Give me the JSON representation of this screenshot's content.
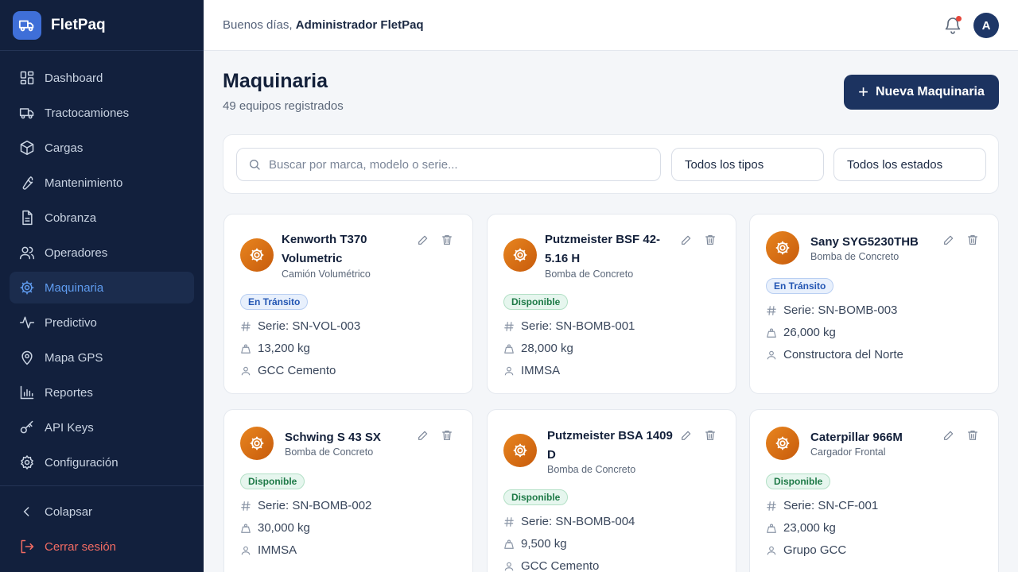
{
  "app": {
    "name": "FletPaq"
  },
  "sidebar": {
    "items": [
      {
        "label": "Dashboard",
        "icon": "grid-icon"
      },
      {
        "label": "Tractocamiones",
        "icon": "truck-icon"
      },
      {
        "label": "Cargas",
        "icon": "box-icon"
      },
      {
        "label": "Mantenimiento",
        "icon": "wrench-icon"
      },
      {
        "label": "Cobranza",
        "icon": "document-icon"
      },
      {
        "label": "Operadores",
        "icon": "users-icon"
      },
      {
        "label": "Maquinaria",
        "icon": "gear-icon",
        "active": true
      },
      {
        "label": "Predictivo",
        "icon": "activity-icon"
      },
      {
        "label": "Mapa GPS",
        "icon": "map-pin-icon"
      },
      {
        "label": "Reportes",
        "icon": "bar-chart-icon"
      },
      {
        "label": "API Keys",
        "icon": "key-icon"
      },
      {
        "label": "Configuración",
        "icon": "settings-icon"
      }
    ],
    "collapse_label": "Colapsar",
    "logout_label": "Cerrar sesión"
  },
  "header": {
    "greeting": "Buenos días,",
    "user_name": "Administrador FletPaq",
    "avatar_initial": "A",
    "has_notification": true
  },
  "page": {
    "title": "Maquinaria",
    "subtitle": "49 equipos registrados",
    "new_button_label": "Nueva Maquinaria"
  },
  "filters": {
    "search_placeholder": "Buscar por marca, modelo o serie...",
    "type_filter": "Todos los tipos",
    "status_filter": "Todos los estados"
  },
  "colors": {
    "sidebar_bg": "#12203d",
    "accent": "#1c3360",
    "active_nav": "#5f9cf0",
    "icon_orange": "#e07a1a",
    "transit": "#2356b3",
    "available": "#1e7a47",
    "logout": "#f26b63"
  },
  "machines": [
    {
      "title_1": "Kenworth T370",
      "title_2": "Volumetric",
      "type": "Camión Volumétrico",
      "status": "En Tránsito",
      "status_kind": "transit",
      "serial": "Serie: SN-VOL-003",
      "weight": "13,200 kg",
      "client": "GCC Cemento"
    },
    {
      "title_1": "Putzmeister BSF 42-",
      "title_2": "5.16 H",
      "type": "Bomba de Concreto",
      "status": "Disponible",
      "status_kind": "available",
      "serial": "Serie: SN-BOMB-001",
      "weight": "28,000 kg",
      "client": "IMMSA"
    },
    {
      "title_1": "Sany SYG5230THB",
      "title_2": "",
      "type": "Bomba de Concreto",
      "status": "En Tránsito",
      "status_kind": "transit",
      "serial": "Serie: SN-BOMB-003",
      "weight": "26,000 kg",
      "client": "Constructora del Norte"
    },
    {
      "title_1": "Schwing S 43 SX",
      "title_2": "",
      "type": "Bomba de Concreto",
      "status": "Disponible",
      "status_kind": "available",
      "serial": "Serie: SN-BOMB-002",
      "weight": "30,000 kg",
      "client": "IMMSA"
    },
    {
      "title_1": "Putzmeister BSA 1409",
      "title_2": "D",
      "type": "Bomba de Concreto",
      "status": "Disponible",
      "status_kind": "available",
      "serial": "Serie: SN-BOMB-004",
      "weight": "9,500 kg",
      "client": "GCC Cemento"
    },
    {
      "title_1": "Caterpillar 966M",
      "title_2": "",
      "type": "Cargador Frontal",
      "status": "Disponible",
      "status_kind": "available",
      "serial": "Serie: SN-CF-001",
      "weight": "23,000 kg",
      "client": "Grupo GCC"
    }
  ]
}
